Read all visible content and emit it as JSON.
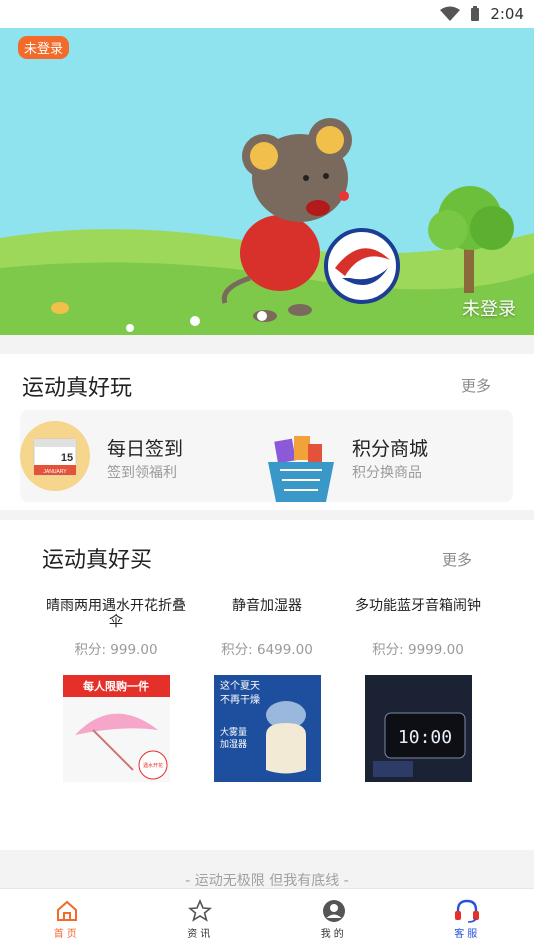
{
  "status_bar": {
    "time": "2:04",
    "icons": [
      "wifi-icon",
      "battery-icon"
    ]
  },
  "banner": {
    "badge": "未登录",
    "corner_label": "未登录"
  },
  "section_play": {
    "title": "运动真好玩",
    "more": "更多",
    "features": [
      {
        "title": "每日签到",
        "subtitle": "签到领福利",
        "icon": "calendar-icon",
        "calendar_day": "15",
        "calendar_month": "JANUARY"
      },
      {
        "title": "积分商城",
        "subtitle": "积分换商品",
        "icon": "shopping-basket-icon"
      }
    ]
  },
  "section_buy": {
    "title": "运动真好买",
    "more": "更多",
    "products": [
      {
        "name": "晴雨两用遇水开花折叠伞",
        "price": "积分: 999.00",
        "image_texts": [
          "每人限购一件",
          "遇水开花"
        ]
      },
      {
        "name": "静音加湿器",
        "price": "积分: 6499.00",
        "image_texts": [
          "这个夏天",
          "不再干燥",
          "大雾量",
          "加湿器"
        ]
      },
      {
        "name": "多功能蓝牙音箱闹钟",
        "price": "积分: 9999.00",
        "image_texts": [
          "10:00"
        ]
      }
    ]
  },
  "footer_text": "- 运动无极限 但我有底线 -",
  "tabbar": {
    "tabs": [
      {
        "label": "首页",
        "icon": "home-icon",
        "active": true
      },
      {
        "label": "资讯",
        "icon": "star-icon",
        "active": false
      },
      {
        "label": "我的",
        "icon": "user-icon",
        "active": false
      },
      {
        "label": "客服",
        "icon": "headset-icon",
        "active": false
      }
    ]
  },
  "colors": {
    "accent_orange": "#f36a2a",
    "accent_blue": "#2a52d9",
    "sky": "#8fe3ef",
    "grass": "#7ec94a"
  }
}
